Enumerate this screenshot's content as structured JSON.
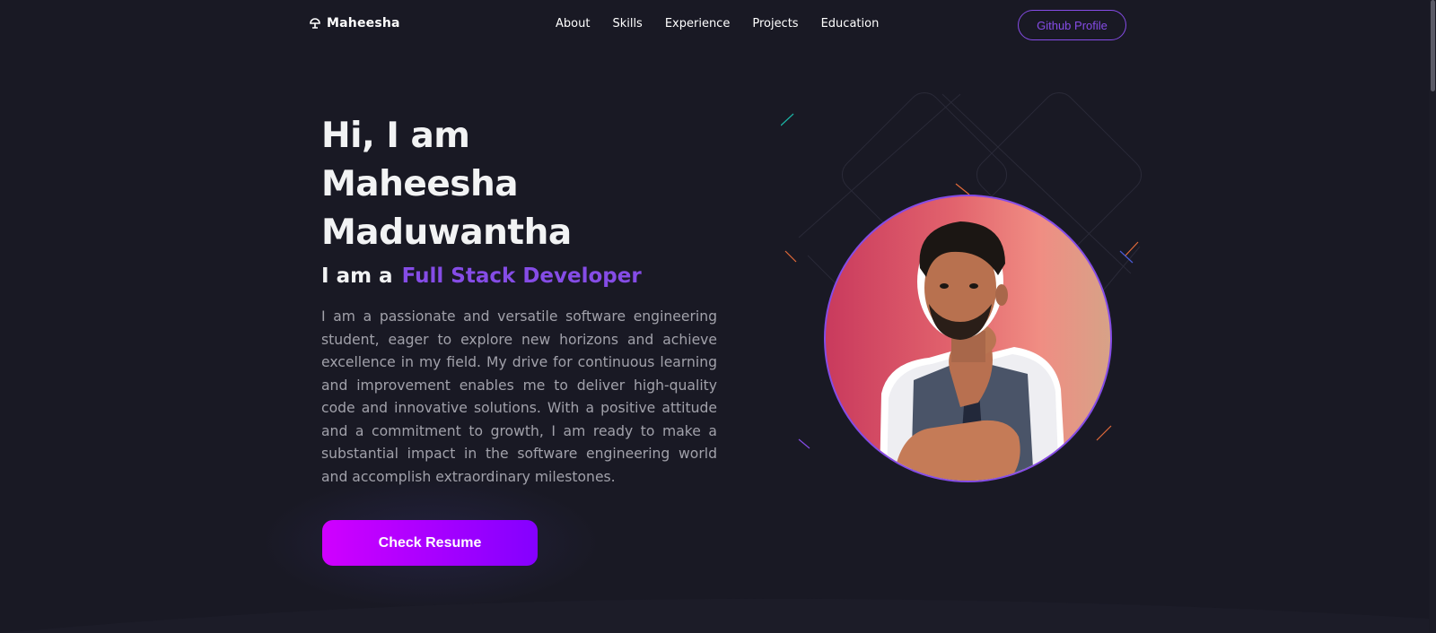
{
  "nav": {
    "logo_text": "Maheesha",
    "links": [
      "About",
      "Skills",
      "Experience",
      "Projects",
      "Education"
    ],
    "github_label": "Github Profile"
  },
  "hero": {
    "title_line1": "Hi, I am",
    "title_line2": "Maheesha",
    "title_line3": "Maduwantha",
    "role_prefix": "I am a",
    "role_text": "Full Stack Developer",
    "description": "I am a passionate and versatile software engineering student, eager to explore new horizons and achieve excellence in my field. My drive for continuous learning and improvement enables me to deliver high-quality code and innovative solutions. With a positive attitude and a commitment to growth, I am ready to make a substantial impact in the software engineering world and accomplish extraordinary milestones.",
    "resume_label": "Check Resume"
  },
  "colors": {
    "background": "#191924",
    "accent": "#854ce6",
    "text": "#f2f3f4",
    "muted": "#a1a1aa",
    "button_start": "#d000ff",
    "button_end": "#8400ff"
  },
  "icons": {
    "logo": "code-logo-icon"
  }
}
